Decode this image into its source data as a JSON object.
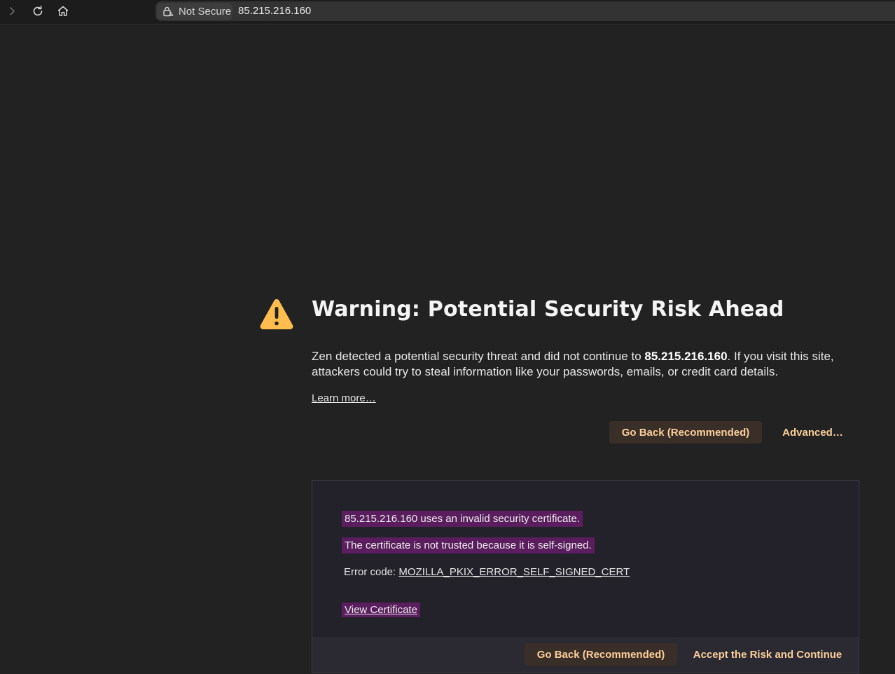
{
  "toolbar": {
    "forward_icon": "chevron-right-icon",
    "reload_icon": "reload-icon",
    "home_icon": "home-icon"
  },
  "urlbar": {
    "security_label": "Not Secure",
    "security_icon": "lock-warning-icon",
    "url": "85.215.216.160"
  },
  "page": {
    "title": "Warning: Potential Security Risk Ahead",
    "desc_before": "Zen detected a potential security threat and did not continue to ",
    "desc_host": "85.215.216.160",
    "desc_after": ". If you visit this site, attackers could try to steal information like your passwords, emails, or credit card details.",
    "learn_more": "Learn more…",
    "go_back_label": "Go Back (Recommended)",
    "advanced_label": "Advanced…"
  },
  "advanced": {
    "invalid_cert": "85.215.216.160 uses an invalid security certificate.",
    "not_trusted": "The certificate is not trusted because it is self-signed.",
    "error_prefix": "Error code: ",
    "error_code": "MOZILLA_PKIX_ERROR_SELF_SIGNED_CERT",
    "view_certificate": "View Certificate",
    "go_back_label": "Go Back (Recommended)",
    "accept_label": "Accept the Risk and Continue"
  },
  "colors": {
    "background": "#222222",
    "accent_button_text": "#fbcf9a",
    "highlight": "#5a1e5e",
    "warning_icon": "#ffbd4f"
  }
}
